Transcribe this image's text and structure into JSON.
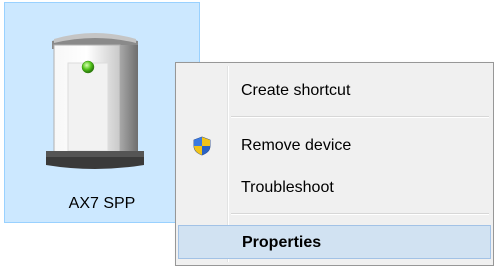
{
  "device": {
    "name": "AX7 SPP",
    "icon": "speaker-device-icon"
  },
  "context_menu": {
    "items": [
      {
        "label": "Create shortcut",
        "icon": null
      },
      {
        "label": "Remove device",
        "icon": "uac-shield-icon"
      },
      {
        "label": "Troubleshoot",
        "icon": null
      },
      {
        "label": "Properties",
        "icon": null,
        "default": true,
        "highlighted": true
      }
    ]
  },
  "colors": {
    "selection_bg": "#cce8ff",
    "menu_bg": "#f0f0f0",
    "menu_highlight": "#d1e2f2"
  }
}
